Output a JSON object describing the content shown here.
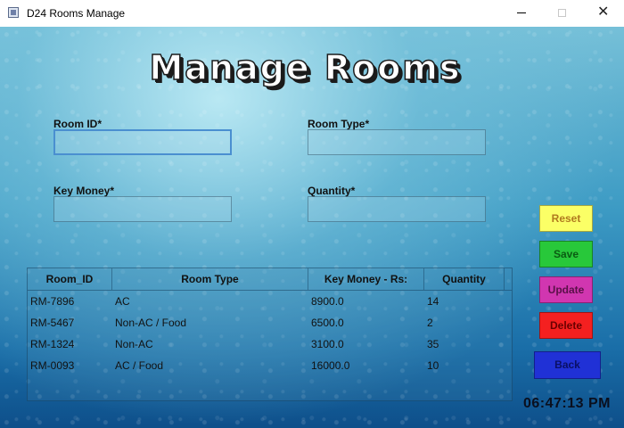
{
  "window": {
    "title": "D24 Rooms Manage",
    "minimize_icon": "minimize-icon",
    "maximize_icon": "maximize-icon",
    "close_icon": "close-icon",
    "close_glyph": "✕"
  },
  "header": {
    "title": "Manage Rooms"
  },
  "form": {
    "room_id": {
      "label": "Room ID*",
      "value": ""
    },
    "room_type": {
      "label": "Room Type*",
      "value": ""
    },
    "key_money": {
      "label": "Key Money*",
      "value": ""
    },
    "quantity": {
      "label": "Quantity*",
      "value": ""
    }
  },
  "table": {
    "columns": [
      "Room_ID",
      "Room Type",
      "Key Money - Rs:",
      "Quantity"
    ],
    "rows": [
      [
        "RM-7896",
        "AC",
        "8900.0",
        "14"
      ],
      [
        "RM-5467",
        "Non-AC / Food",
        "6500.0",
        "2"
      ],
      [
        "RM-1324",
        "Non-AC",
        "3100.0",
        "35"
      ],
      [
        "RM-0093",
        "AC / Food",
        "16000.0",
        "10"
      ]
    ]
  },
  "buttons": {
    "reset": "Reset",
    "save": "Save",
    "update": "Update",
    "delete": "Delete",
    "back": "Back"
  },
  "clock": "06:47:13 PM",
  "colors": {
    "reset": "#fbff66",
    "save": "#28c83a",
    "update": "#d136b0",
    "delete": "#f42020",
    "back": "#2031d6"
  }
}
